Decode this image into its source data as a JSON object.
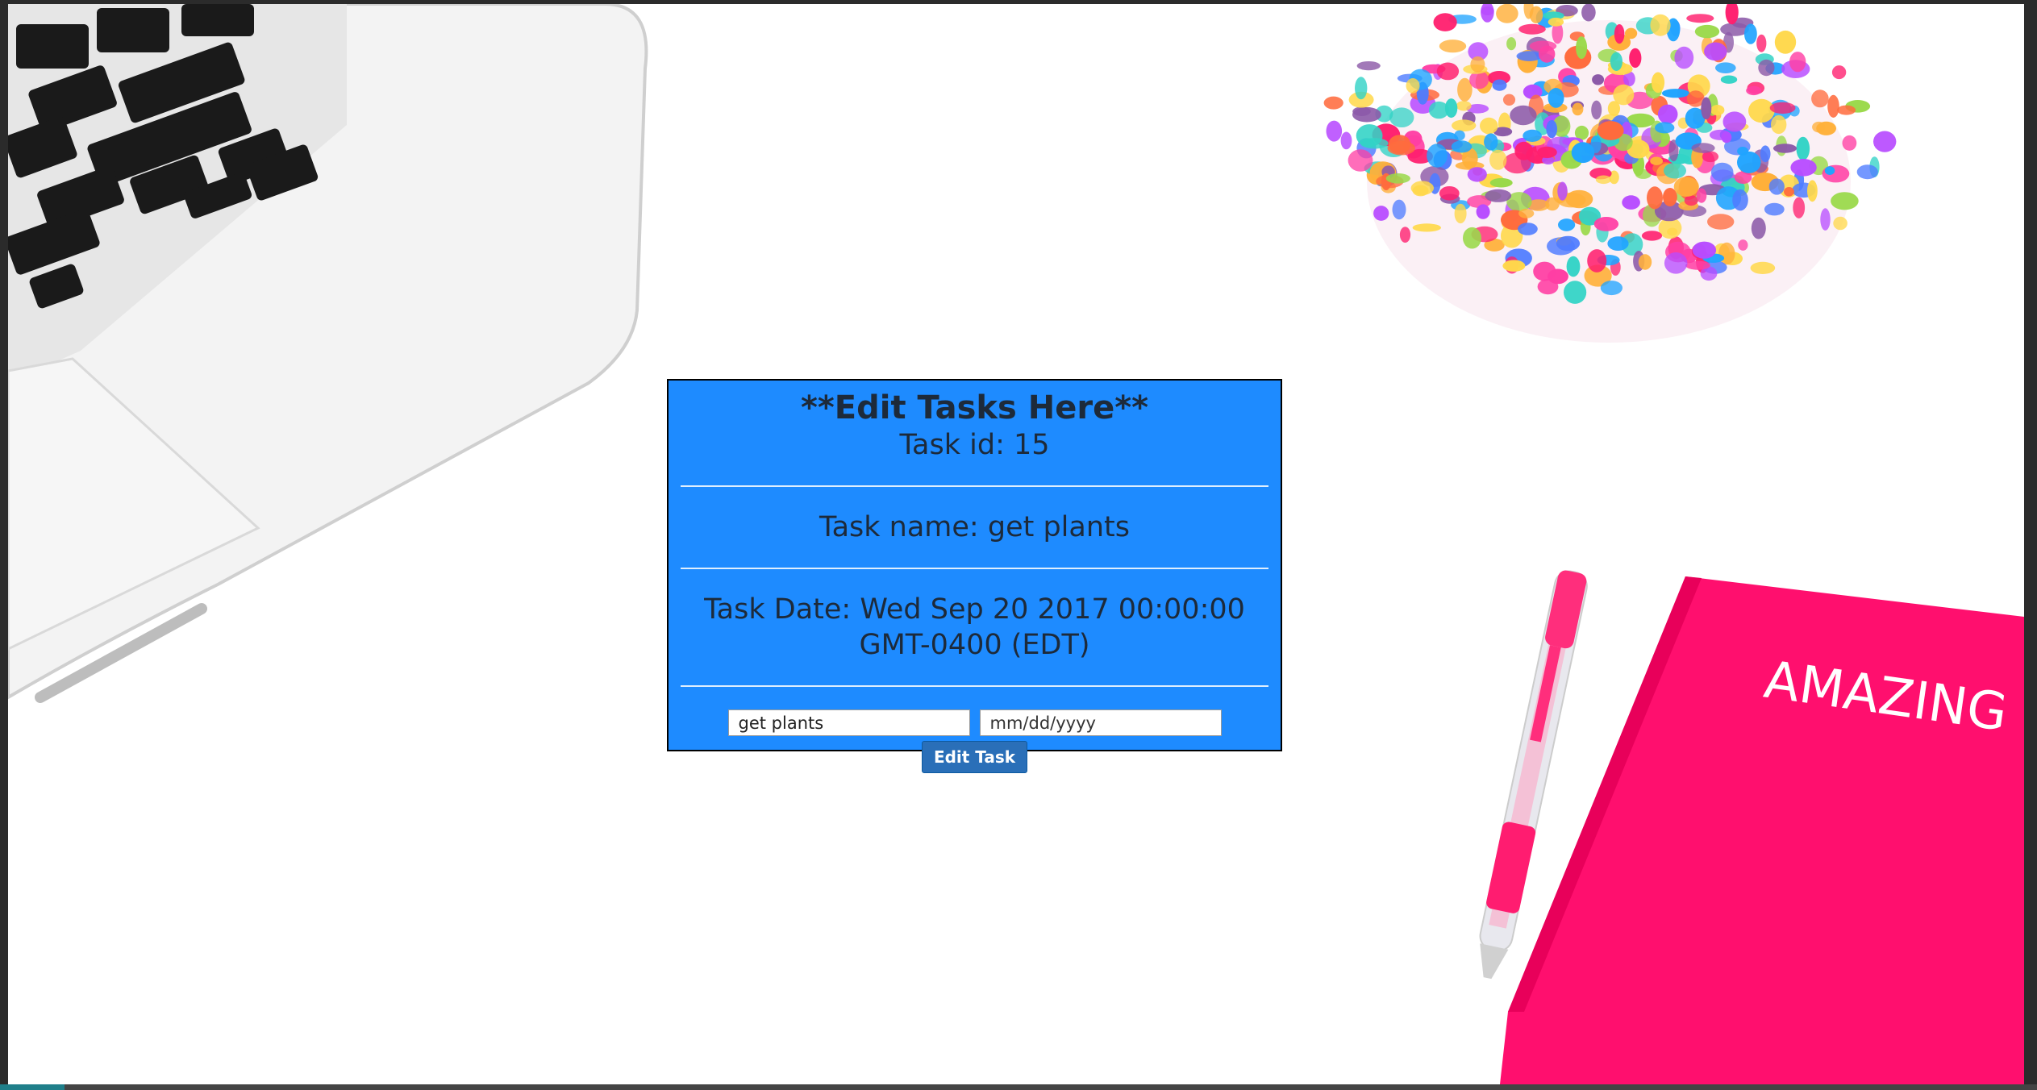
{
  "card": {
    "title": "**Edit Tasks Here**",
    "task_id_line": "Task id: 15",
    "task_name_line": "Task name: get plants",
    "task_date_line": "Task Date: Wed Sep 20 2017 00:00:00 GMT-0400 (EDT)"
  },
  "form": {
    "name_value": "get plants",
    "date_placeholder": "mm/dd/yyyy",
    "submit_label": "Edit Task"
  },
  "background": {
    "notebook_text": "AMAZING"
  },
  "colors": {
    "card_background": "#1e8bff",
    "text": "#1d2a3a",
    "button_background": "#2a6fb8",
    "notebook_pink": "#ff0f6e"
  }
}
